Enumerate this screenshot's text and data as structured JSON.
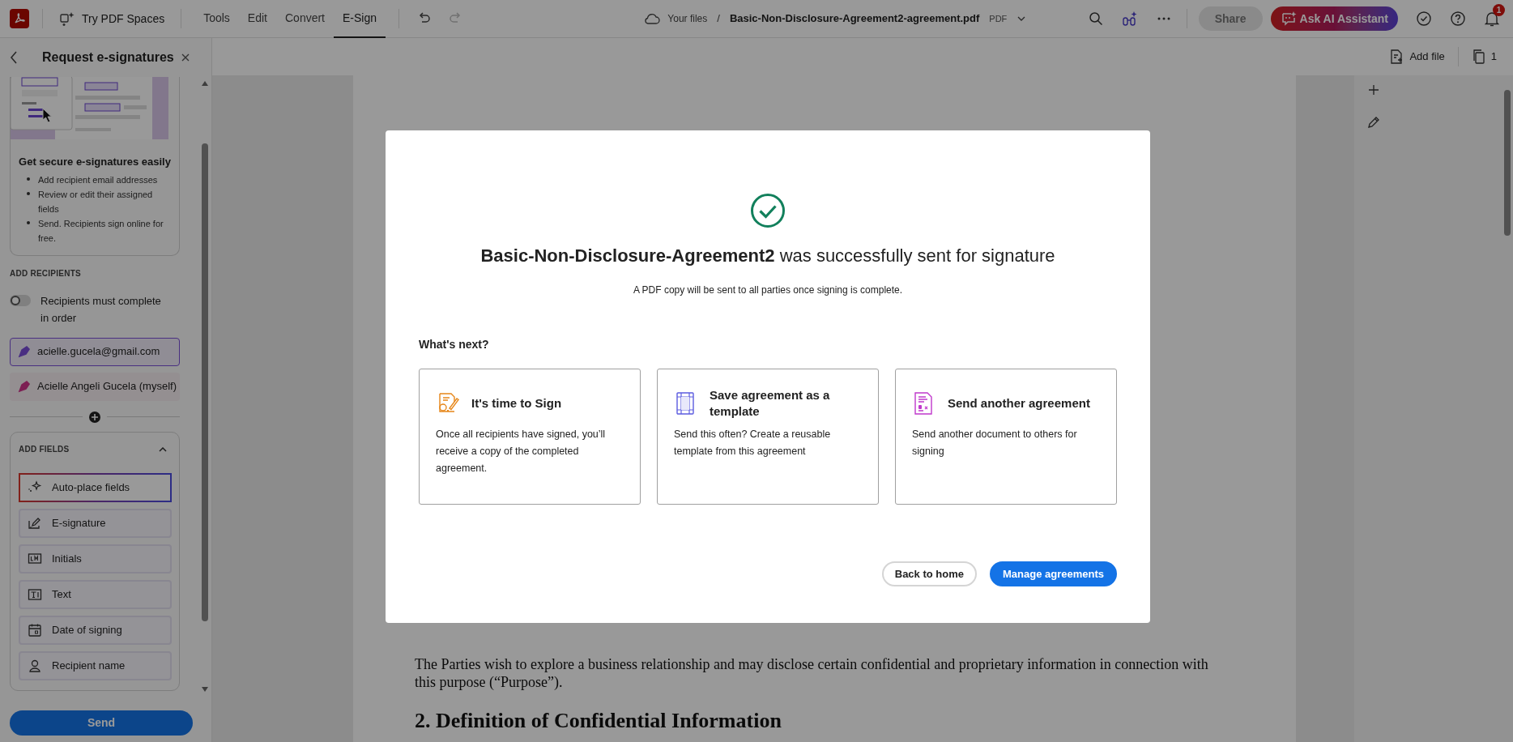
{
  "app_bar": {
    "spaces_button": "Try PDF Spaces",
    "menu": [
      {
        "label": "Tools",
        "selected": false
      },
      {
        "label": "Edit",
        "selected": false
      },
      {
        "label": "Convert",
        "selected": false
      },
      {
        "label": "E-Sign",
        "selected": true
      }
    ],
    "breadcrumb_root": "Your files",
    "separator": "/",
    "file_name": "Basic-Non-Disclosure-Agreement2-agreement.pdf",
    "file_type": "PDF",
    "share_button": {
      "label": "Share",
      "disabled": true
    },
    "ai_button": "Ask AI Assistant",
    "notification_count": "1"
  },
  "sidebar": {
    "title": "Request e-signatures",
    "promo": {
      "title": "Get secure e-signatures easily",
      "bullets": [
        "Add recipient email addresses",
        "Review or edit their assigned fields",
        "Send. Recipients sign online for free."
      ]
    },
    "recipients_heading": "ADD RECIPIENTS",
    "order_toggle": {
      "label": "Recipients must complete in order",
      "on": false
    },
    "recipients": [
      {
        "label": "acielle.gucela@gmail.com",
        "color": "#4a2f82",
        "selected": true
      },
      {
        "label": "Acielle Angeli Gucela (myself)",
        "color": "#7d1f53",
        "selected": false
      }
    ],
    "fields_heading": "ADD FIELDS",
    "fields_expanded": true,
    "fields": [
      {
        "label": "Auto-place fields",
        "kind": "auto"
      },
      {
        "label": "E-signature",
        "kind": "signature"
      },
      {
        "label": "Initials",
        "kind": "initials"
      },
      {
        "label": "Text",
        "kind": "text"
      },
      {
        "label": "Date of signing",
        "kind": "date"
      },
      {
        "label": "Recipient name",
        "kind": "name"
      }
    ],
    "send_button": "Send"
  },
  "document_toolbar": {
    "add_file": "Add file",
    "page_count": "1"
  },
  "document": {
    "sections": [
      {
        "body": "The Parties wish to explore a business relationship and may disclose certain confidential and proprietary information in connection with this purpose (“Purpose”)."
      },
      {
        "heading": "2. Definition of Confidential Information"
      }
    ]
  },
  "dialog": {
    "title": "**Basic-Non-Disclosure-Agreement2** was successfully sent for signature",
    "subtitle": "A PDF copy will be sent to all parties once signing is complete.",
    "next_heading": "What's next?",
    "options": [
      {
        "kind": "sign",
        "title": "It's time to Sign",
        "text": "Once all recipients have signed, you’ll receive a copy of the completed agreement."
      },
      {
        "kind": "template",
        "title": "Save agreement as a template",
        "text": "Send this often? Create a reusable template from this agreement"
      },
      {
        "kind": "send",
        "title": "Send another agreement",
        "text": "Send another document to others for signing"
      }
    ],
    "buttons": [
      {
        "label": "Back to home",
        "kind": "secondary"
      },
      {
        "label": "Manage agreements",
        "kind": "primary"
      }
    ]
  }
}
